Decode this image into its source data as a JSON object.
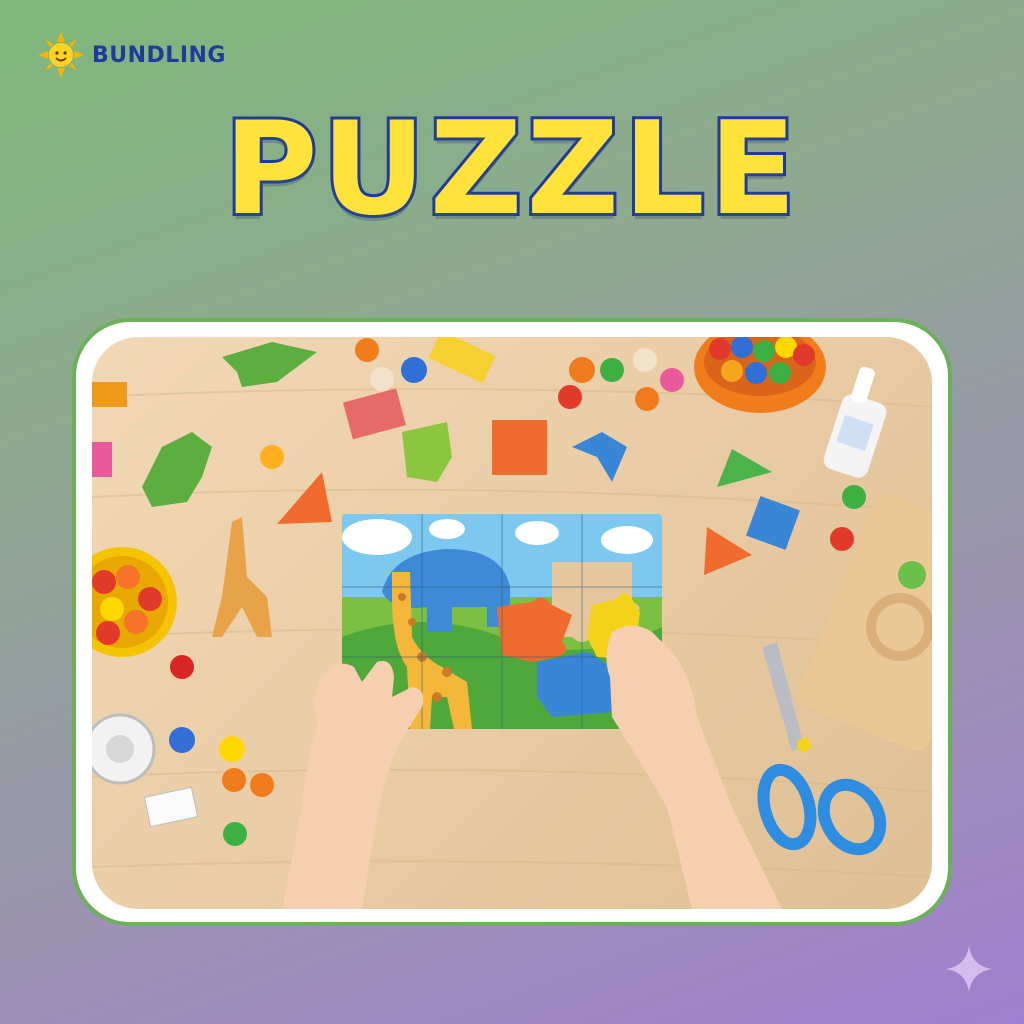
{
  "brand": {
    "name": "BUNDLING",
    "logo_icon": "sun-icon"
  },
  "title": "PUZZLE",
  "photo": {
    "subject": "child-hands-solving-jigsaw-puzzle"
  },
  "decoration": {
    "corner_icon": "sparkle-icon"
  },
  "colors": {
    "title_fill": "#ffe23a",
    "title_stroke": "#1f3c9c",
    "frame_border": "#6db05a",
    "brand_text": "#1f3c9c"
  }
}
